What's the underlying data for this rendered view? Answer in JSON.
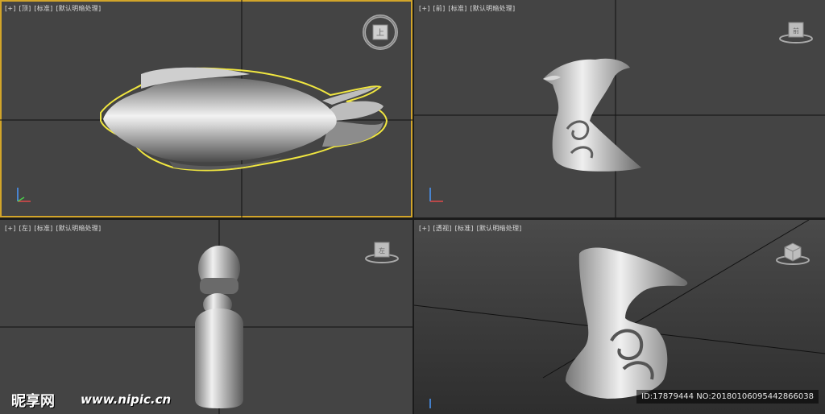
{
  "viewports": [
    {
      "plus": "[+]",
      "view": "[顶]",
      "shading": "[标准]",
      "lighting": "[默认明暗处理]"
    },
    {
      "plus": "[+]",
      "view": "[前]",
      "shading": "[标准]",
      "lighting": "[默认明暗处理]"
    },
    {
      "plus": "[+]",
      "view": "[左]",
      "shading": "[标准]",
      "lighting": "[默认明暗处理]"
    },
    {
      "plus": "[+]",
      "view": "[透视]",
      "shading": "[标准]",
      "lighting": "[默认明暗处理]"
    }
  ],
  "viewcube_labels": {
    "top": "上",
    "front": "前",
    "left": "左"
  },
  "watermark": {
    "logo": "昵享网",
    "url": "www.nipic.cn",
    "id_text": "ID:17879444 NO:20180106095442866038"
  },
  "colors": {
    "viewport_bg": "#444444",
    "active_border": "#d2a52a",
    "selection_outline": "#f0e640",
    "grid_line": "#101010"
  }
}
